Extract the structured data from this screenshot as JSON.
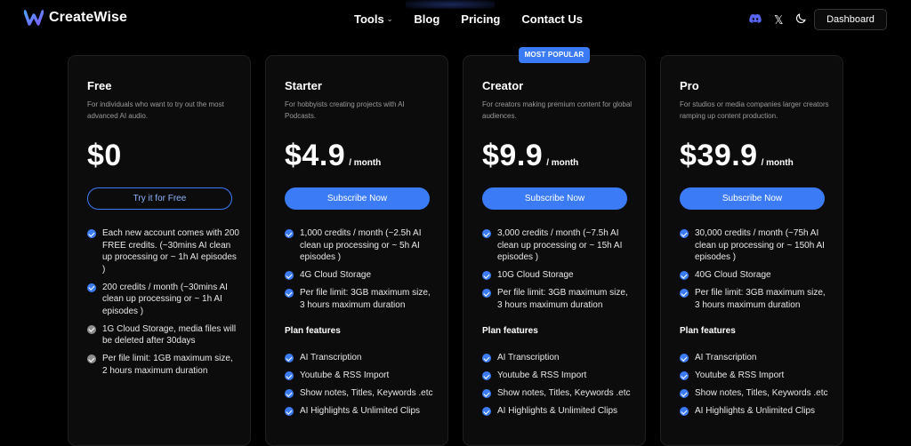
{
  "brand": {
    "name": "CreateWise"
  },
  "nav": {
    "links": [
      {
        "label": "Tools",
        "has_dropdown": true
      },
      {
        "label": "Blog"
      },
      {
        "label": "Pricing"
      },
      {
        "label": "Contact Us"
      }
    ],
    "icons": [
      "discord-icon",
      "x-icon",
      "moon-icon"
    ],
    "dashboard_label": "Dashboard"
  },
  "badge": "MOST POPULAR",
  "plan_features_title": "Plan features",
  "colors": {
    "accent": "#3b7cf6",
    "background": "#000000",
    "card": "#0c0c0c"
  },
  "plans": [
    {
      "name": "Free",
      "description": "For individuals who want to try out the most advanced AI audio.",
      "price": "$0",
      "period": "",
      "cta": "Try it for Free",
      "features": [
        {
          "text": "Each new account comes with 200 FREE credits. (~30mins AI clean up processing or ~ 1h AI episodes )",
          "gray": false
        },
        {
          "text": "200 credits / month (~30mins AI clean up processing or ~ 1h AI episodes )",
          "gray": false
        },
        {
          "text": "1G Cloud Storage, media files will be deleted after 30days",
          "gray": true
        },
        {
          "text": "Per file limit: 1GB maximum size, 2 hours maximum duration",
          "gray": true
        }
      ]
    },
    {
      "name": "Starter",
      "description": "For hobbyists creating projects with AI Podcasts.",
      "price": "$4.9",
      "period": "/ month",
      "cta": "Subscribe Now",
      "features": [
        {
          "text": "1,000 credits / month (~2.5h AI clean up processing or ~ 5h AI episodes )"
        },
        {
          "text": "4G Cloud Storage"
        },
        {
          "text": "Per file limit: 3GB maximum size, 3 hours maximum duration"
        }
      ],
      "plan_features": [
        "AI Transcription",
        "Youtube & RSS Import",
        "Show notes, Titles, Keywords .etc",
        "AI Highlights & Unlimited Clips"
      ]
    },
    {
      "name": "Creator",
      "description": "For creators making premium content for global audiences.",
      "price": "$9.9",
      "period": "/ month",
      "cta": "Subscribe Now",
      "features": [
        {
          "text": "3,000 credits / month (~7.5h AI clean up processing or ~ 15h AI episodes )"
        },
        {
          "text": "10G Cloud Storage"
        },
        {
          "text": "Per file limit: 3GB maximum size, 3 hours maximum duration"
        }
      ],
      "plan_features": [
        "AI Transcription",
        "Youtube & RSS Import",
        "Show notes, Titles, Keywords .etc",
        "AI Highlights & Unlimited Clips"
      ]
    },
    {
      "name": "Pro",
      "description": "For studios or media companies larger creators ramping up content production.",
      "price": "$39.9",
      "period": "/ month",
      "cta": "Subscribe Now",
      "features": [
        {
          "text": "30,000 credits / month (~75h AI clean up processing or ~ 150h AI episodes )"
        },
        {
          "text": "40G Cloud Storage"
        },
        {
          "text": "Per file limit: 3GB maximum size, 3 hours maximum duration"
        }
      ],
      "plan_features": [
        "AI Transcription",
        "Youtube & RSS Import",
        "Show notes, Titles, Keywords .etc",
        "AI Highlights & Unlimited Clips"
      ]
    }
  ]
}
